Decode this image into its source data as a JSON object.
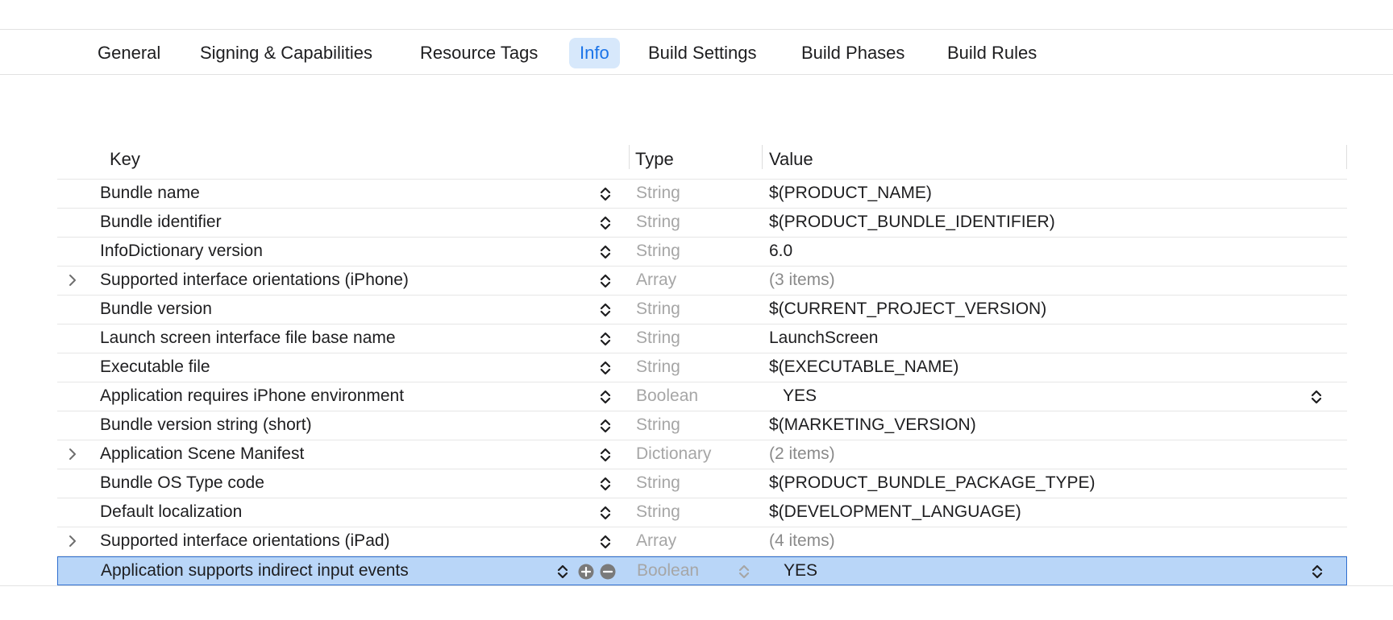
{
  "tabs": [
    {
      "label": "General"
    },
    {
      "label": "Signing & Capabilities"
    },
    {
      "label": "Resource Tags"
    },
    {
      "label": "Info"
    },
    {
      "label": "Build Settings"
    },
    {
      "label": "Build Phases"
    },
    {
      "label": "Build Rules"
    }
  ],
  "active_tab": "Info",
  "accent_color": "#1a73e8",
  "selection_color": "#b9d6f8",
  "columns": {
    "key": "Key",
    "type": "Type",
    "value": "Value"
  },
  "rows": [
    {
      "key": "Bundle name",
      "type": "String",
      "value": "$(PRODUCT_NAME)"
    },
    {
      "key": "Bundle identifier",
      "type": "String",
      "value": "$(PRODUCT_BUNDLE_IDENTIFIER)"
    },
    {
      "key": "InfoDictionary version",
      "type": "String",
      "value": "6.0"
    },
    {
      "key": "Supported interface orientations (iPhone)",
      "type": "Array",
      "value": "(3 items)",
      "expandable": true
    },
    {
      "key": "Bundle version",
      "type": "String",
      "value": "$(CURRENT_PROJECT_VERSION)"
    },
    {
      "key": "Launch screen interface file base name",
      "type": "String",
      "value": "LaunchScreen"
    },
    {
      "key": "Executable file",
      "type": "String",
      "value": "$(EXECUTABLE_NAME)"
    },
    {
      "key": "Application requires iPhone environment",
      "type": "Boolean",
      "value": "YES"
    },
    {
      "key": "Bundle version string (short)",
      "type": "String",
      "value": "$(MARKETING_VERSION)"
    },
    {
      "key": "Application Scene Manifest",
      "type": "Dictionary",
      "value": "(2 items)",
      "expandable": true
    },
    {
      "key": "Bundle OS Type code",
      "type": "String",
      "value": "$(PRODUCT_BUNDLE_PACKAGE_TYPE)"
    },
    {
      "key": "Default localization",
      "type": "String",
      "value": "$(DEVELOPMENT_LANGUAGE)"
    },
    {
      "key": "Supported interface orientations (iPad)",
      "type": "Array",
      "value": "(4 items)",
      "expandable": true
    },
    {
      "key": "Application supports indirect input events",
      "type": "Boolean",
      "value": "YES",
      "selected": true
    }
  ]
}
